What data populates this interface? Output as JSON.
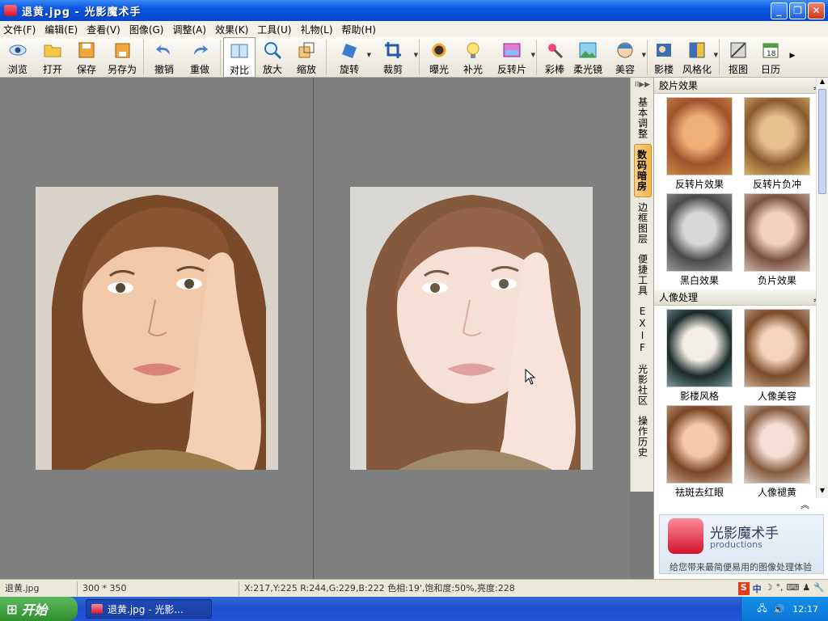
{
  "window": {
    "title": "退黄.jpg - 光影魔术手"
  },
  "menu": [
    "文件(F)",
    "编辑(E)",
    "查看(V)",
    "图像(G)",
    "调整(A)",
    "效果(K)",
    "工具(U)",
    "礼物(L)",
    "帮助(H)"
  ],
  "toolbar": {
    "browse": "浏览",
    "open": "打开",
    "save": "保存",
    "saveas": "另存为",
    "undo": "撤销",
    "redo": "重做",
    "compare": "对比",
    "zoomin": "放大",
    "resize": "缩放",
    "rotate": "旋转",
    "crop": "裁剪",
    "exposure": "曝光",
    "filllight": "补光",
    "reversal": "反转片",
    "colorpen": "彩棒",
    "softlens": "柔光镜",
    "beauty": "美容",
    "studio": "影楼",
    "stylize": "风格化",
    "cutout": "抠图",
    "calendar": "日历"
  },
  "vtabs": [
    "基本调整",
    "数码暗房",
    "边框图层",
    "便捷工具",
    "EXIF",
    "光影社区",
    "操作历史"
  ],
  "sidebar": {
    "section1": "胶片效果",
    "film_effects": [
      "反转片效果",
      "反转片负冲",
      "黑白效果",
      "负片效果"
    ],
    "section2": "人像处理",
    "portrait": [
      "影楼风格",
      "人像美容",
      "祛斑去红眼",
      "人像褪黄"
    ]
  },
  "ad": {
    "brand": "光影魔术手",
    "sub": "productions",
    "slogan": "给您带来最简便易用的图像处理体验"
  },
  "status": {
    "file": "退黄.jpg",
    "size": "300 * 350",
    "info": "X:217,Y:225 R:244,G:229,B:222 色相:19',饱和度:50%,亮度:228"
  },
  "taskbar": {
    "start": "开始",
    "item": "退黄.jpg - 光影...",
    "clock": "12:17"
  }
}
